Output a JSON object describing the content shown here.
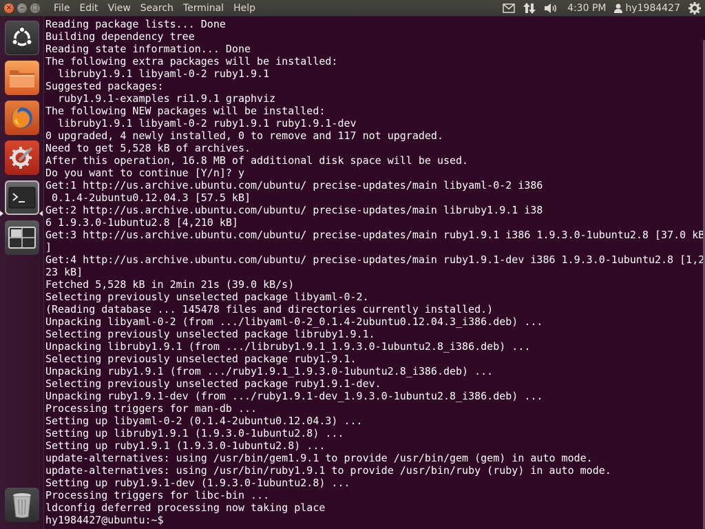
{
  "menubar": {
    "items": [
      "File",
      "Edit",
      "View",
      "Search",
      "Terminal",
      "Help"
    ],
    "clock": "4:30 PM",
    "username": "hy1984427"
  },
  "launcher": {
    "items": [
      {
        "name": "dash-home",
        "icon": "ubuntu-logo-icon"
      },
      {
        "name": "files",
        "icon": "folder-icon"
      },
      {
        "name": "firefox",
        "icon": "firefox-icon"
      },
      {
        "name": "system-settings",
        "icon": "settings-icon"
      },
      {
        "name": "terminal",
        "icon": "terminal-icon"
      },
      {
        "name": "workspace-switcher",
        "icon": "workspace-icon"
      },
      {
        "name": "trash",
        "icon": "trash-icon"
      }
    ]
  },
  "terminal": {
    "lines": [
      "Reading package lists... Done",
      "Building dependency tree",
      "Reading state information... Done",
      "The following extra packages will be installed:",
      "  libruby1.9.1 libyaml-0-2 ruby1.9.1",
      "Suggested packages:",
      "  ruby1.9.1-examples ri1.9.1 graphviz",
      "The following NEW packages will be installed:",
      "  libruby1.9.1 libyaml-0-2 ruby1.9.1 ruby1.9.1-dev",
      "0 upgraded, 4 newly installed, 0 to remove and 117 not upgraded.",
      "Need to get 5,528 kB of archives.",
      "After this operation, 16.8 MB of additional disk space will be used.",
      "Do you want to continue [Y/n]? y",
      "Get:1 http://us.archive.ubuntu.com/ubuntu/ precise-updates/main libyaml-0-2 i386",
      " 0.1.4-2ubuntu0.12.04.3 [57.5 kB]",
      "Get:2 http://us.archive.ubuntu.com/ubuntu/ precise-updates/main libruby1.9.1 i38",
      "6 1.9.3.0-1ubuntu2.8 [4,210 kB]",
      "Get:3 http://us.archive.ubuntu.com/ubuntu/ precise-updates/main ruby1.9.1 i386 1.9.3.0-1ubuntu2.8 [37.0 kB",
      "]",
      "Get:4 http://us.archive.ubuntu.com/ubuntu/ precise-updates/main ruby1.9.1-dev i386 1.9.3.0-1ubuntu2.8 [1,2",
      "23 kB]",
      "Fetched 5,528 kB in 2min 21s (39.0 kB/s)",
      "Selecting previously unselected package libyaml-0-2.",
      "(Reading database ... 145478 files and directories currently installed.)",
      "Unpacking libyaml-0-2 (from .../libyaml-0-2_0.1.4-2ubuntu0.12.04.3_i386.deb) ...",
      "Selecting previously unselected package libruby1.9.1.",
      "Unpacking libruby1.9.1 (from .../libruby1.9.1_1.9.3.0-1ubuntu2.8_i386.deb) ...",
      "Selecting previously unselected package ruby1.9.1.",
      "Unpacking ruby1.9.1 (from .../ruby1.9.1_1.9.3.0-1ubuntu2.8_i386.deb) ...",
      "Selecting previously unselected package ruby1.9.1-dev.",
      "Unpacking ruby1.9.1-dev (from .../ruby1.9.1-dev_1.9.3.0-1ubuntu2.8_i386.deb) ...",
      "Processing triggers for man-db ...",
      "Setting up libyaml-0-2 (0.1.4-2ubuntu0.12.04.3) ...",
      "Setting up libruby1.9.1 (1.9.3.0-1ubuntu2.8) ...",
      "Setting up ruby1.9.1 (1.9.3.0-1ubuntu2.8) ...",
      "update-alternatives: using /usr/bin/gem1.9.1 to provide /usr/bin/gem (gem) in auto mode.",
      "update-alternatives: using /usr/bin/ruby1.9.1 to provide /usr/bin/ruby (ruby) in auto mode.",
      "Setting up ruby1.9.1-dev (1.9.3.0-1ubuntu2.8) ...",
      "Processing triggers for libc-bin ...",
      "ldconfig deferred processing now taking place"
    ],
    "prompt": "hy1984427@ubuntu:~$"
  },
  "colors": {
    "terminal_bg": "#300a24",
    "panel_bg": "#3b3a36",
    "close_button": "#df4a16"
  }
}
